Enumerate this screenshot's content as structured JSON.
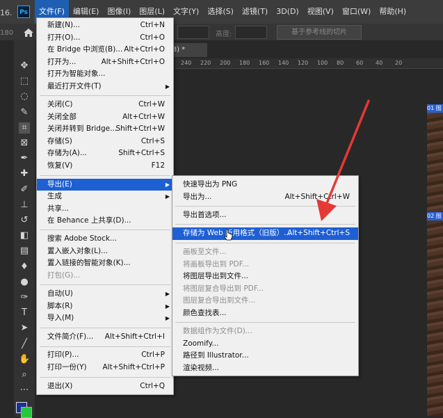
{
  "app": {
    "logo": "Ps",
    "version_fragment": "16.",
    "version_fragment2": "180",
    "menubar": [
      {
        "label": "文件(F)",
        "active": true
      },
      {
        "label": "编辑(E)"
      },
      {
        "label": "图像(I)"
      },
      {
        "label": "图层(L)"
      },
      {
        "label": "文字(Y)"
      },
      {
        "label": "选择(S)"
      },
      {
        "label": "滤镜(T)"
      },
      {
        "label": "3D(D)"
      },
      {
        "label": "视图(V)"
      },
      {
        "label": "窗口(W)"
      },
      {
        "label": "帮助(H)"
      }
    ]
  },
  "options_bar": {
    "height_label": "高度:",
    "guide_slices_button": "基于参考线的切片"
  },
  "document": {
    "tab_title": "3/8) *",
    "ruler_ticks": [
      "240",
      "220",
      "200",
      "180",
      "160",
      "140",
      "120",
      "100",
      "80",
      "60",
      "40",
      "20"
    ],
    "layer_tag_1": "01 图",
    "layer_tag_2": "02 图"
  },
  "colors": {
    "foreground": "#1b2f9b",
    "background": "#27c73b",
    "highlight": "#1e5fd4",
    "arrow": "#e53935"
  },
  "tools": [
    "move-icon",
    "marquee-icon",
    "lasso-icon",
    "quick-select-icon",
    "crop-icon",
    "frame-icon",
    "eyedropper-icon",
    "healing-icon",
    "brush-icon",
    "stamp-icon",
    "history-brush-icon",
    "eraser-icon",
    "gradient-icon",
    "blur-icon",
    "dodge-icon",
    "pen-icon",
    "type-icon",
    "path-select-icon",
    "line-icon",
    "hand-icon",
    "zoom-icon",
    "more-icon"
  ],
  "file_menu": {
    "new": {
      "label": "新建(N)...",
      "shortcut": "Ctrl+N"
    },
    "open": {
      "label": "打开(O)...",
      "shortcut": "Ctrl+O"
    },
    "browse_bridge": {
      "label": "在 Bridge 中浏览(B)...",
      "shortcut": "Alt+Ctrl+O"
    },
    "open_as": {
      "label": "打开为...",
      "shortcut": "Alt+Shift+Ctrl+O"
    },
    "open_smart": {
      "label": "打开为智能对象..."
    },
    "recent": {
      "label": "最近打开文件(T)"
    },
    "close": {
      "label": "关闭(C)",
      "shortcut": "Ctrl+W"
    },
    "close_all": {
      "label": "关闭全部",
      "shortcut": "Alt+Ctrl+W"
    },
    "close_bridge": {
      "label": "关闭并转到 Bridge...",
      "shortcut": "Shift+Ctrl+W"
    },
    "save": {
      "label": "存储(S)",
      "shortcut": "Ctrl+S"
    },
    "save_as": {
      "label": "存储为(A)...",
      "shortcut": "Shift+Ctrl+S"
    },
    "revert": {
      "label": "恢复(V)",
      "shortcut": "F12"
    },
    "export": {
      "label": "导出(E)"
    },
    "generate": {
      "label": "生成"
    },
    "share": {
      "label": "共享..."
    },
    "behance": {
      "label": "在 Behance 上共享(D)..."
    },
    "adobe_stock": {
      "label": "搜索 Adobe Stock..."
    },
    "place_embedded": {
      "label": "置入嵌入对象(L)..."
    },
    "place_linked": {
      "label": "置入链接的智能对象(K)..."
    },
    "package": {
      "label": "打包(G)..."
    },
    "automate": {
      "label": "自动(U)"
    },
    "scripts": {
      "label": "脚本(R)"
    },
    "import": {
      "label": "导入(M)"
    },
    "file_info": {
      "label": "文件简介(F)...",
      "shortcut": "Alt+Shift+Ctrl+I"
    },
    "print": {
      "label": "打印(P)...",
      "shortcut": "Ctrl+P"
    },
    "print_one": {
      "label": "打印一份(Y)",
      "shortcut": "Alt+Shift+Ctrl+P"
    },
    "exit": {
      "label": "退出(X)",
      "shortcut": "Ctrl+Q"
    }
  },
  "export_menu": {
    "quick_png": {
      "label": "快速导出为 PNG"
    },
    "export_as": {
      "label": "导出为...",
      "shortcut": "Alt+Shift+Ctrl+W"
    },
    "export_prefs": {
      "label": "导出首选项..."
    },
    "save_for_web": {
      "label": "存储为 Web 所用格式（旧版）...",
      "shortcut": "Alt+Shift+Ctrl+S"
    },
    "artboards_files": {
      "label": "画板至文件..."
    },
    "artboards_pdf": {
      "label": "将画板导出到 PDF..."
    },
    "layers_files": {
      "label": "将图层导出到文件..."
    },
    "layers_pdf": {
      "label": "将图层复合导出到 PDF..."
    },
    "comps_files": {
      "label": "图层复合导出到文件..."
    },
    "color_lookup": {
      "label": "颜色查找表..."
    },
    "data_sets": {
      "label": "数据组作为文件(D)..."
    },
    "zoomify": {
      "label": "Zoomify..."
    },
    "paths_illustrator": {
      "label": "路径到 Illustrator..."
    },
    "render_video": {
      "label": "渲染视频..."
    }
  }
}
